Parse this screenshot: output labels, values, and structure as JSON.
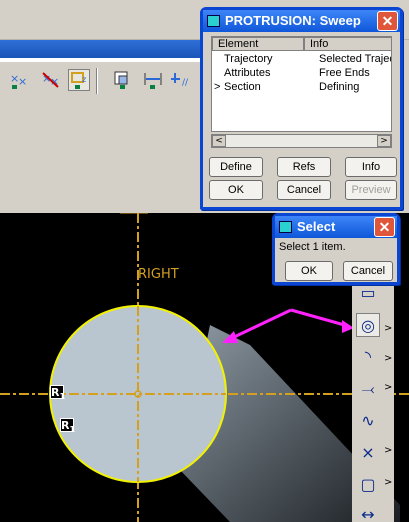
{
  "toolbar": {
    "icons": [
      "dimension-x-icon",
      "delete-dimension-x-icon",
      "datum-filter-icon",
      "repaint-icon",
      "fit-icon",
      "spin-center-icon"
    ]
  },
  "protrusion_dialog": {
    "title": "PROTRUSION: Sweep",
    "close_label": "✕",
    "columns": [
      "Element",
      "Info"
    ],
    "rows": [
      {
        "element": "Trajectory",
        "info": "Selected Trajec",
        "marker": ""
      },
      {
        "element": "Attributes",
        "info": "Free Ends",
        "marker": ""
      },
      {
        "element": "Section",
        "info": "Defining",
        "marker": ">"
      }
    ],
    "scroll_left": "<",
    "scroll_right": ">",
    "buttons": {
      "define": "Define",
      "refs": "Refs",
      "info": "Info",
      "ok": "OK",
      "cancel": "Cancel",
      "preview": "Preview"
    }
  },
  "select_dialog": {
    "title": "Select",
    "close_label": "✕",
    "message": "Select 1 item.",
    "ok": "OK",
    "cancel": "Cancel"
  },
  "canvas": {
    "datum_label": "RIGHT",
    "marks": [
      "R",
      "R"
    ],
    "mark_subs": [
      "1",
      "1"
    ],
    "colors": {
      "background": "#000000",
      "datum": "#d4a020",
      "section_fill": "#b9c6d0",
      "section_edge": "#f2f200",
      "annotation_arrow": "#ff22ff"
    }
  },
  "palette": {
    "items": [
      {
        "name": "rectangle-icon",
        "glyph": "▭",
        "arrow": ""
      },
      {
        "name": "circle-icon",
        "glyph": "◎",
        "arrow": ">"
      },
      {
        "name": "arc-icon",
        "glyph": "◝",
        "arrow": ">"
      },
      {
        "name": "fillet-icon",
        "glyph": "⤙",
        "arrow": ">"
      },
      {
        "name": "spline-icon",
        "glyph": "∿",
        "arrow": ""
      },
      {
        "name": "point-icon",
        "glyph": "×",
        "arrow": ">"
      },
      {
        "name": "offset-edge-icon",
        "glyph": "▢",
        "arrow": ">"
      },
      {
        "name": "dimension-icon",
        "glyph": "↔",
        "arrow": ""
      }
    ]
  }
}
